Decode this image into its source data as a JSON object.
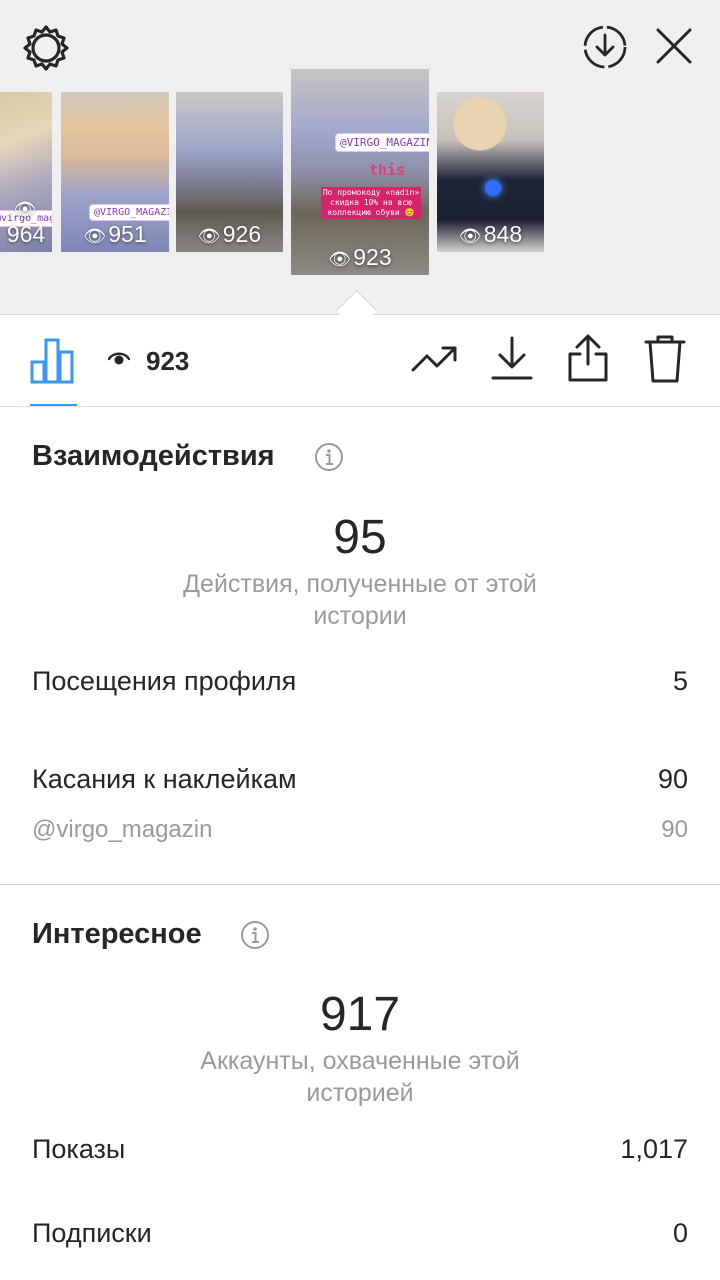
{
  "header": {
    "settings_icon": "gear-icon",
    "save_icon": "download-circle-icon",
    "close_icon": "close-icon"
  },
  "thumbnails": [
    {
      "views": "964",
      "sticker": "@virgo_magazin"
    },
    {
      "views": "951",
      "sticker": "@VIRGO_MAGAZIN"
    },
    {
      "views": "926"
    },
    {
      "views": "923",
      "sticker": "@VIRGO_MAGAZIN",
      "overlay_text": "this",
      "promo_text": "По промокоду «nadin» скидка 10% на всю коллекцию обуви 😊"
    },
    {
      "views": "848"
    }
  ],
  "toolbar": {
    "views_count": "923",
    "icons": [
      "bar-chart-icon",
      "eye-icon",
      "trend-icon",
      "download-icon",
      "share-icon",
      "trash-icon"
    ]
  },
  "interactions": {
    "title": "Взаимодействия",
    "total": "95",
    "total_caption": "Действия, полученные от этой истории",
    "rows": [
      {
        "label": "Посещения профиля",
        "value": "5"
      },
      {
        "label": "Касания к наклейкам",
        "value": "90"
      }
    ],
    "sub_row": {
      "label": "@virgo_magazin",
      "value": "90"
    }
  },
  "discovery": {
    "title": "Интересное",
    "total": "917",
    "total_caption": "Аккаунты, охваченные этой историей",
    "rows": [
      {
        "label": "Показы",
        "value": "1,017"
      },
      {
        "label": "Подписки",
        "value": "0"
      }
    ]
  },
  "colors": {
    "accent": "#3897f0",
    "text": "#262626",
    "muted": "#9a9a9a",
    "top_bg": "#efefef"
  }
}
